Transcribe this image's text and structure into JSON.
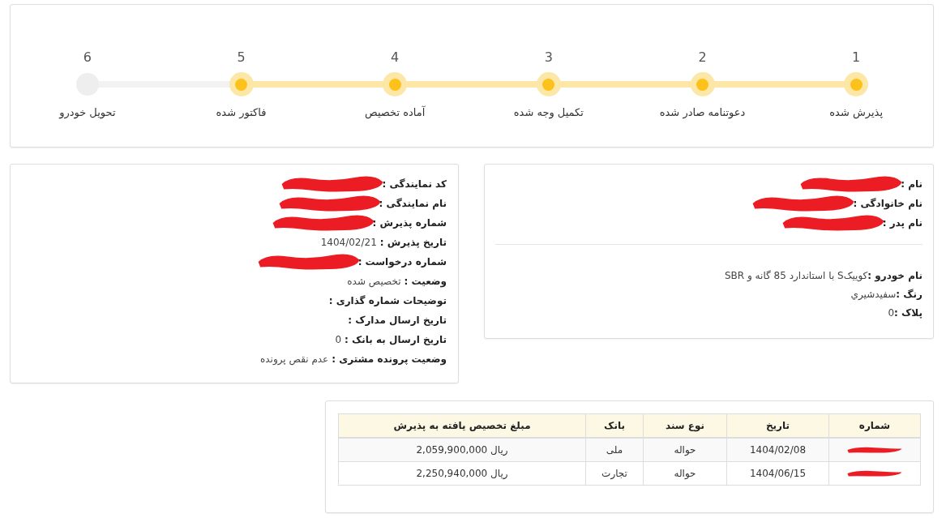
{
  "steps": [
    {
      "number": "1",
      "label": "پذیرش شده",
      "done": true
    },
    {
      "number": "2",
      "label": "دعوتنامه صادر شده",
      "done": true
    },
    {
      "number": "3",
      "label": "تکمیل وجه شده",
      "done": true
    },
    {
      "number": "4",
      "label": "آماده تخصیص",
      "done": true
    },
    {
      "number": "5",
      "label": "فاکتور شده",
      "done": true
    },
    {
      "number": "6",
      "label": "تحویل خودرو",
      "done": false
    }
  ],
  "customer": {
    "person": [
      {
        "label": "نام :",
        "redacted": true
      },
      {
        "label": "نام خانوادگی :",
        "redacted": true
      },
      {
        "label": "نام پدر :",
        "redacted": true
      }
    ],
    "vehicle": [
      {
        "label": "نام خودرو :",
        "value": "کوییکS با استاندارد 85 گانه و SBR",
        "redacted": false
      },
      {
        "label": "رنگ :",
        "value": "سفیدشيري",
        "redacted": false
      },
      {
        "label": "پلاک :",
        "value": "0",
        "redacted": false
      }
    ]
  },
  "reception": [
    {
      "label": "کد نمایندگی :",
      "redacted": true
    },
    {
      "label": "نام نمایندگی :",
      "redacted": true
    },
    {
      "label": "شماره پذیرش :",
      "redacted": true
    },
    {
      "label": "تاریخ پذیرش :",
      "value": "1404/02/21",
      "redacted": false
    },
    {
      "label": "شماره درخواست :",
      "redacted": true
    },
    {
      "label": "وضعیت :",
      "value": "تخصیص شده",
      "redacted": false
    },
    {
      "label": "توضیحات شماره گذاری :",
      "redacted": false
    },
    {
      "label": "تاریخ ارسال مدارک :",
      "redacted": false
    },
    {
      "label": "تاریخ ارسال به بانک :",
      "value": "0",
      "redacted": false
    },
    {
      "label": "وضعیت پرونده مشتری :",
      "value": "عدم نقص پرونده",
      "redacted": false
    }
  ],
  "table": {
    "columns": [
      "شماره",
      "تاریخ",
      "نوع سند",
      "بانک",
      "مبلغ تخصیص یافته به پذیرش"
    ],
    "rows": [
      {
        "number_redacted": true,
        "date": "1404/02/08",
        "doc_type": "حواله",
        "bank": "ملی",
        "amount": "2,059,900,000 ریال"
      },
      {
        "number_redacted": true,
        "date": "1404/06/15",
        "doc_type": "حواله",
        "bank": "تجارت",
        "amount": "2,250,940,000 ریال"
      }
    ]
  }
}
